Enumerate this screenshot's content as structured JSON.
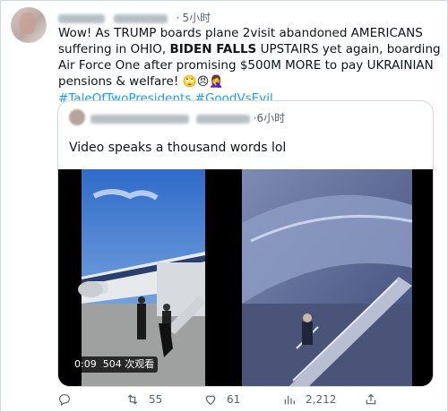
{
  "tweet": {
    "time": "5小时",
    "text_1": "Wow! As TRUMP boards plane 2visit abandoned AMERICANS suffering in OHIO, ",
    "text_bold": "BIDEN FALLS",
    "text_2": " UPSTAIRS yet again, boarding Air Force One after promising $500M MORE to pay UKRAINIAN pensions & welfare! ",
    "emojis": "🙄😠🤦‍♀️",
    "hashtags": "#TaleOfTwoPresidents #GoodVsEvil"
  },
  "quote": {
    "time": "6小时",
    "text": "Video speaks a thousand words lol",
    "video_time": "0:09",
    "video_views": "504 次观看"
  },
  "actions": {
    "reply_count": "",
    "retweet_count": "55",
    "like_count": "61",
    "view_count": "2,212"
  },
  "colors": {
    "link": "#1d9bf0",
    "muted": "#536471",
    "border": "#cfd9de"
  },
  "icons": [
    "reply-icon",
    "retweet-icon",
    "like-icon",
    "views-icon",
    "share-icon"
  ]
}
